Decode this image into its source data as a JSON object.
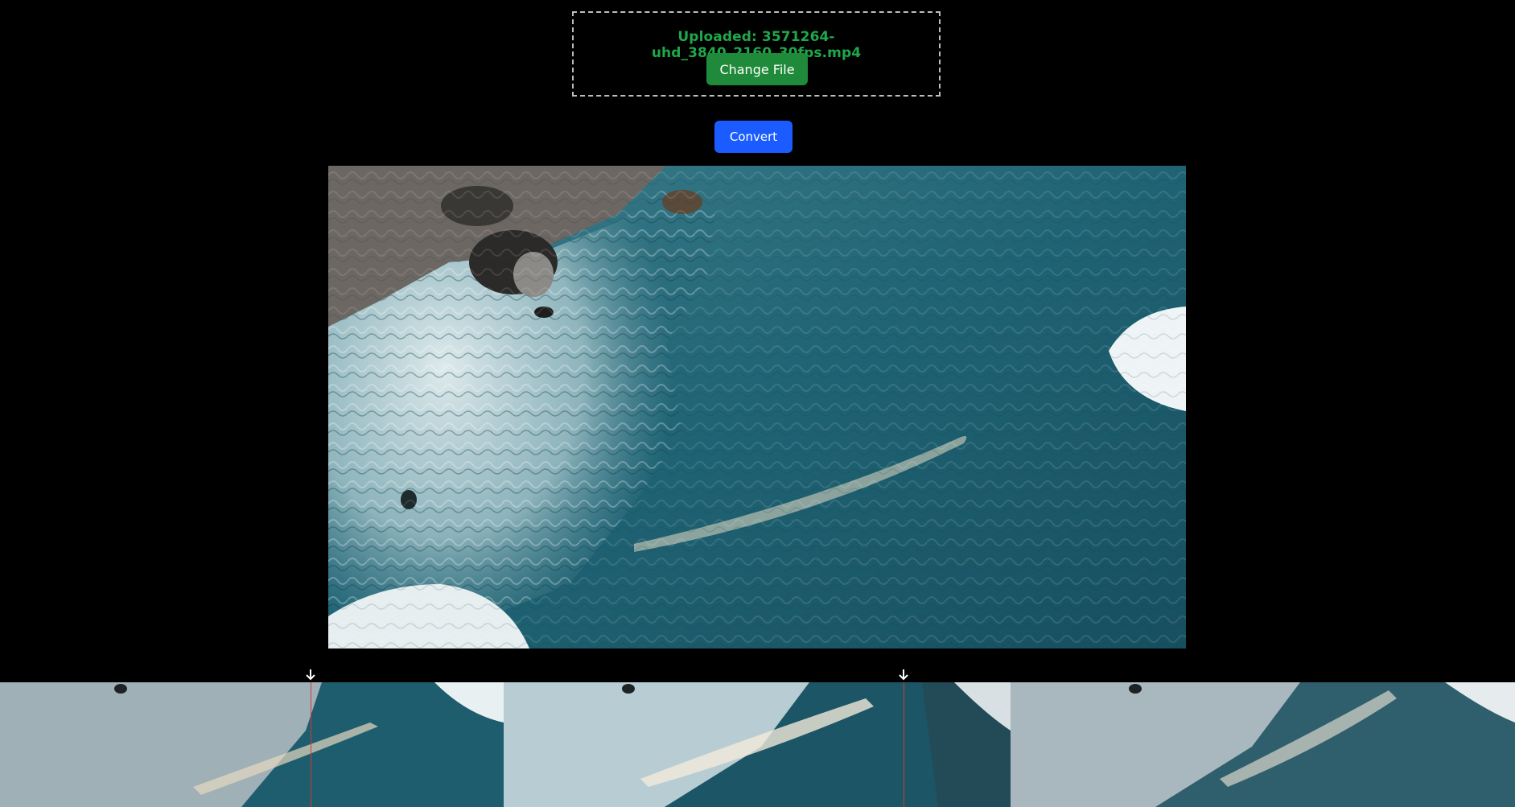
{
  "upload": {
    "status_text": "Uploaded: 3571264-uhd_3840_2160_30fps.mp4",
    "change_button_label": "Change File"
  },
  "actions": {
    "convert_button_label": "Convert"
  },
  "colors": {
    "background": "#000000",
    "status_green": "#1fa84a",
    "change_button": "#1f8a3a",
    "convert_button": "#1a5cff",
    "marker_line": "#d23a3a"
  },
  "timeline": {
    "thumbnail_count": 3,
    "markers": 2
  }
}
